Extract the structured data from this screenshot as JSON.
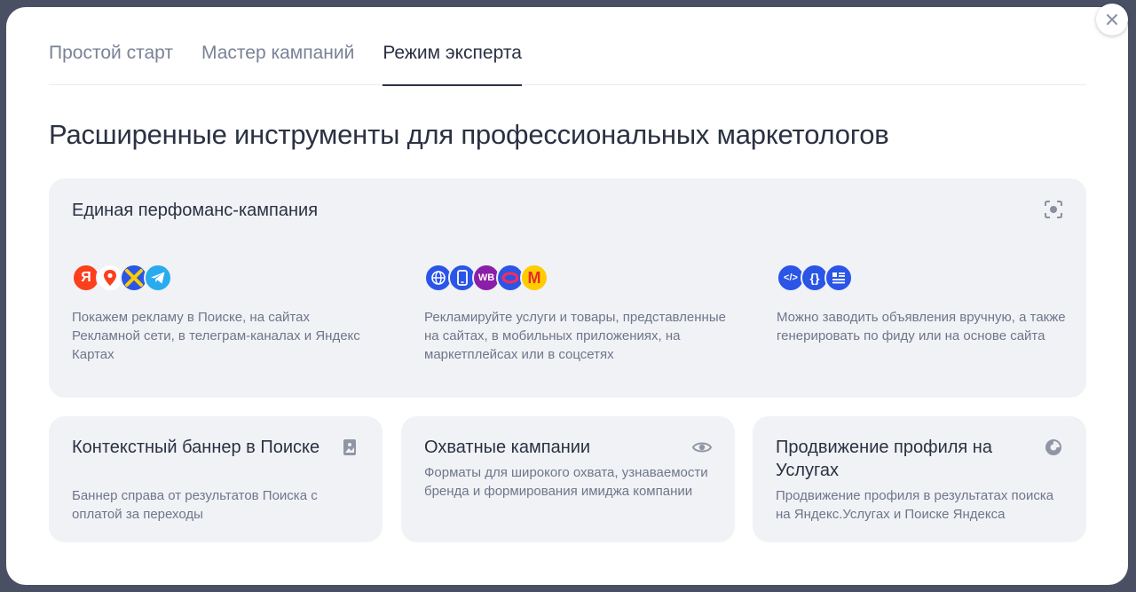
{
  "tabs": [
    {
      "label": "Простой старт",
      "active": false
    },
    {
      "label": "Мастер кампаний",
      "active": false
    },
    {
      "label": "Режим эксперта",
      "active": true
    }
  ],
  "heading": "Расширенные инструменты для профессиональных маркетологов",
  "performance_card": {
    "title": "Единая перфоманс-кампания",
    "columns": [
      {
        "icons": [
          "yandex-icon",
          "maps-pin-icon",
          "network-icon",
          "telegram-icon"
        ],
        "icon_texts": [
          "Я",
          "",
          "",
          ""
        ],
        "description": "Покажем рекламу в Поиске, на сайтах Рекламной сети, в телеграм-каналах и Яндекс Картах"
      },
      {
        "icons": [
          "globe-icon",
          "mobile-icon",
          "wildberries-icon",
          "ozon-icon",
          "market-icon"
        ],
        "icon_texts": [
          "",
          "",
          "WB",
          "",
          "M"
        ],
        "description": "Рекламируйте услуги и товары, представленные на сайтах, в мобильных приложениях, на маркетплейсах или в соцсетях"
      },
      {
        "icons": [
          "code-icon",
          "braces-icon",
          "feed-list-icon"
        ],
        "icon_texts": [
          "</>",
          "{}",
          ""
        ],
        "description": "Можно заводить объявления вручную, а также генерировать по фиду или на основе сайта"
      }
    ]
  },
  "small_cards": [
    {
      "title": "Контекстный баннер в Поиске",
      "description": "Баннер справа от результатов Поиска с оплатой за переходы",
      "icon": "image-icon"
    },
    {
      "title": "Охватные кампании",
      "description": "Форматы для широкого охвата, узнаваемости бренда и формирования имиджа компании",
      "icon": "eye-icon"
    },
    {
      "title": "Продвижение профиля на Услугах",
      "description": "Продвижение профиля в результатах поиска на Яндекс.Услугах и Поиске Яндекса",
      "icon": "services-icon"
    }
  ],
  "colors": {
    "title": "#2b3142",
    "muted": "#6f7689",
    "card_bg": "#f0f2f6",
    "yandex_red": "#fc3f1d",
    "telegram": "#2aabee",
    "blue": "#2a55e6",
    "wildberries": "#8b1ea8"
  }
}
